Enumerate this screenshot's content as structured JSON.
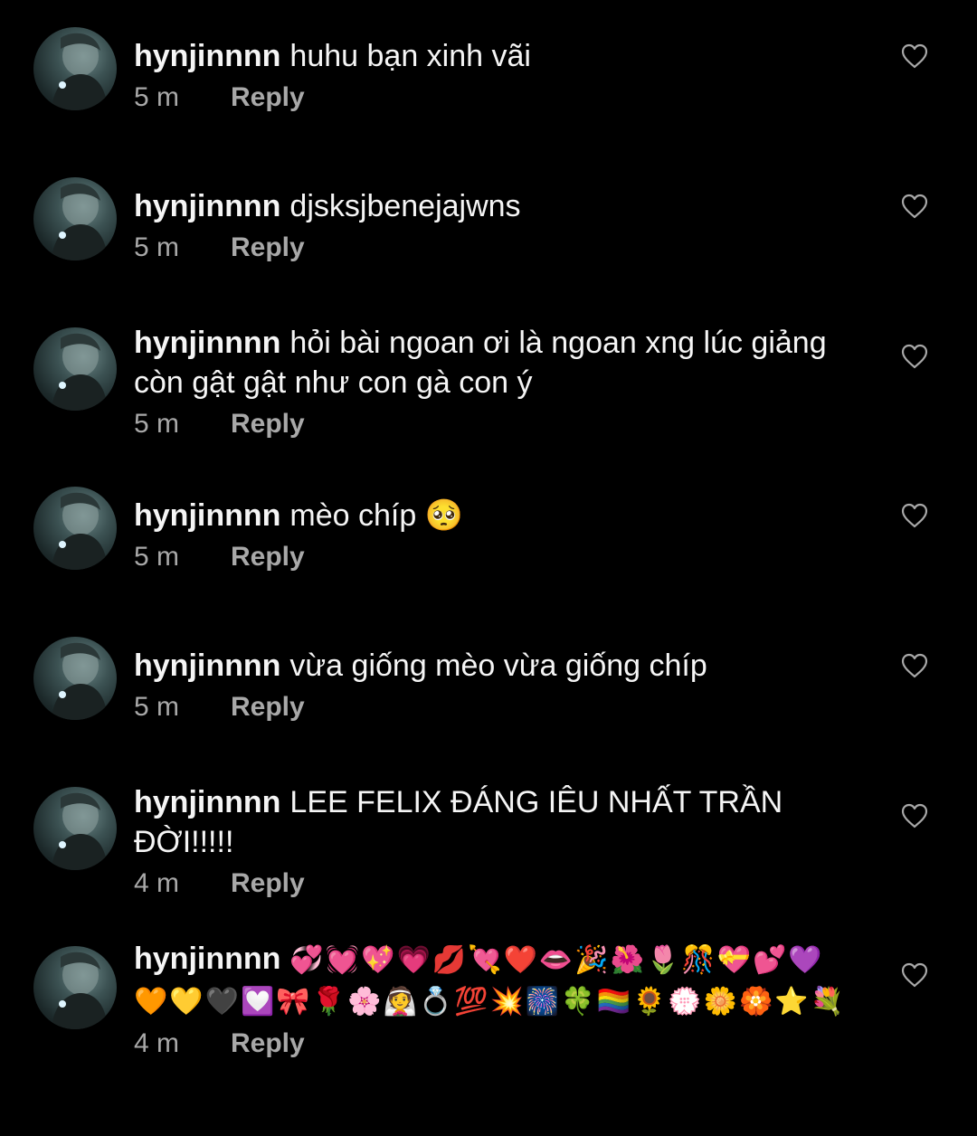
{
  "colors": {
    "background": "#000000",
    "text": "#f5f5f5",
    "secondary": "#a8a8a8",
    "heart_outline": "#a8a8a8"
  },
  "comments": [
    {
      "username": "hynjinnnn",
      "text": "huhu bạn xinh vãi",
      "time": "5 m",
      "reply_label": "Reply",
      "avatar_icon": "profile-photo-icon",
      "like_icon": "heart-outline-icon"
    },
    {
      "username": "hynjinnnn",
      "text": "djsksjbenejajwns",
      "time": "5 m",
      "reply_label": "Reply",
      "avatar_icon": "profile-photo-icon",
      "like_icon": "heart-outline-icon"
    },
    {
      "username": "hynjinnnn",
      "text": "hỏi bài ngoan ơi là ngoan xng lúc giảng còn gật gật như con gà con ý",
      "time": "5 m",
      "reply_label": "Reply",
      "avatar_icon": "profile-photo-icon",
      "like_icon": "heart-outline-icon"
    },
    {
      "username": "hynjinnnn",
      "text": "mèo chíp 🥺",
      "time": "5 m",
      "reply_label": "Reply",
      "avatar_icon": "profile-photo-icon",
      "like_icon": "heart-outline-icon"
    },
    {
      "username": "hynjinnnn",
      "text": "vừa giống mèo vừa giống chíp",
      "time": "5 m",
      "reply_label": "Reply",
      "avatar_icon": "profile-photo-icon",
      "like_icon": "heart-outline-icon"
    },
    {
      "username": "hynjinnnn",
      "text": "LEE FELIX ĐÁNG IÊU NHẤT TRẦN ĐỜI!!!!!",
      "time": "4 m",
      "reply_label": "Reply",
      "avatar_icon": "profile-photo-icon",
      "like_icon": "heart-outline-icon"
    },
    {
      "username": "hynjinnnn",
      "text": "💞💓💖💗💋💘❤️👄🎉🌺🌷🎊💝💕💜🧡💛🖤💟🎀🌹🌸👰💍💯💥🎆🍀🏳️‍🌈🌻💮🌼🏵️⭐💐",
      "time": "4 m",
      "reply_label": "Reply",
      "avatar_icon": "profile-photo-icon",
      "like_icon": "heart-outline-icon"
    }
  ]
}
